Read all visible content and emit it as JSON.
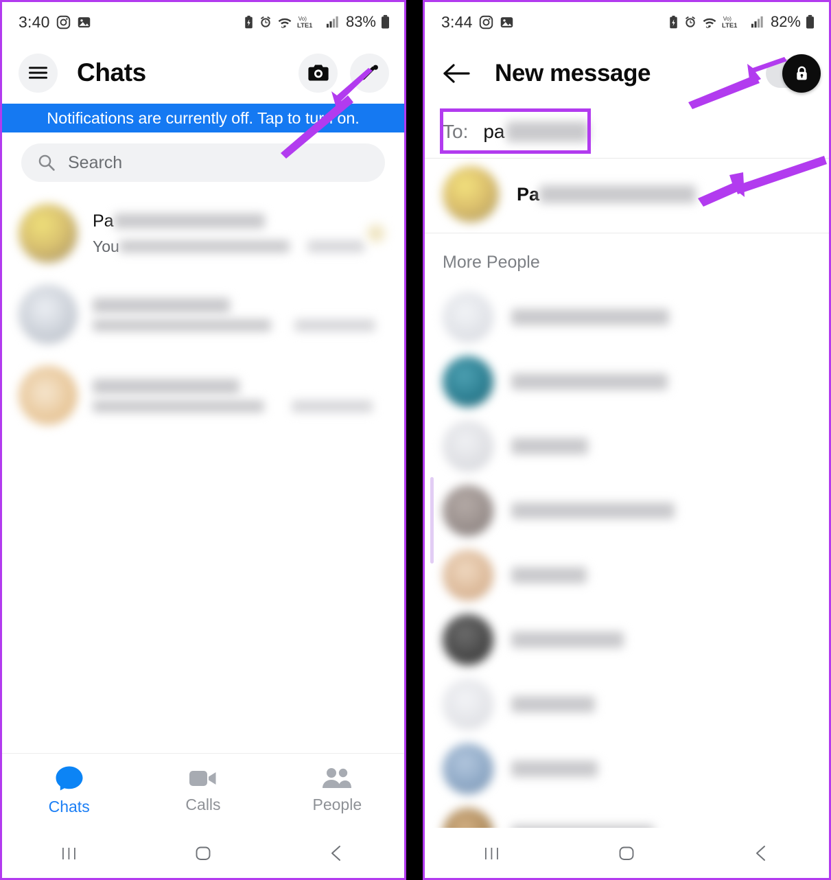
{
  "meta": {
    "accent_purple": "#b23bef",
    "banner_blue": "#1579f2",
    "tab_active_blue": "#1a7ef5"
  },
  "left_panel": {
    "status_bar": {
      "time": "3:40",
      "battery_percent": "83%",
      "network_label": "LTE1",
      "voice_label": "Vo)",
      "icons": [
        "instagram-icon",
        "photos-icon",
        "battery-saver-icon",
        "alarm-icon",
        "wifi-icon",
        "volte-icon",
        "signal-icon",
        "battery-icon"
      ]
    },
    "header": {
      "menu_icon": "hamburger-menu-icon",
      "title": "Chats",
      "camera_icon": "camera-icon",
      "compose_icon": "pencil-compose-icon"
    },
    "banner": {
      "text": "Notifications are currently off. Tap to turn on."
    },
    "search": {
      "icon": "search-icon",
      "placeholder": "Search"
    },
    "chats": [
      {
        "name_visible": "Pa",
        "name_redacted_width": 220,
        "snippet_visible": "You",
        "snippet_redacted_width": 250,
        "time_redacted_width": 84,
        "avatar_color": "#d9c170",
        "has_trailing_dot": true
      },
      {
        "name_visible": "",
        "name_redacted_width": 200,
        "snippet_visible": "",
        "snippet_redacted_width": 260,
        "time_redacted_width": 118,
        "avatar_color": "#c9ced6",
        "has_trailing_dot": false
      },
      {
        "name_visible": "",
        "name_redacted_width": 214,
        "snippet_visible": "",
        "snippet_redacted_width": 250,
        "time_redacted_width": 118,
        "avatar_color": "#e8c79a",
        "has_trailing_dot": false
      }
    ],
    "tabs": [
      {
        "label": "Chats",
        "icon": "chat-bubble-icon",
        "active": true
      },
      {
        "label": "Calls",
        "icon": "video-camera-icon",
        "active": false
      },
      {
        "label": "People",
        "icon": "people-icon",
        "active": false
      }
    ],
    "nav": [
      {
        "icon": "recents-icon"
      },
      {
        "icon": "home-icon"
      },
      {
        "icon": "back-icon"
      }
    ]
  },
  "right_panel": {
    "status_bar": {
      "time": "3:44",
      "battery_percent": "82%",
      "network_label": "LTE1",
      "voice_label": "Vo)"
    },
    "header": {
      "back_icon": "back-arrow-icon",
      "title": "New message",
      "toggle": {
        "name": "end-to-end-encryption-toggle",
        "icon": "lock-icon",
        "state": "on"
      }
    },
    "to_field": {
      "label": "To:",
      "value_visible": "pa",
      "value_redacted_width": 120
    },
    "suggested": {
      "name_visible": "Pa",
      "name_redacted_width": 228,
      "avatar_color": "#dcc06d"
    },
    "section_title": "More People",
    "people": [
      {
        "name_redacted_width": 230,
        "avatar_color": "#e0e2e7"
      },
      {
        "name_redacted_width": 228,
        "avatar_color": "#2d7f92"
      },
      {
        "name_redacted_width": 112,
        "avatar_color": "#dedfe3"
      },
      {
        "name_redacted_width": 238,
        "avatar_color": "#9b918e"
      },
      {
        "name_redacted_width": 110,
        "avatar_color": "#dbb898"
      },
      {
        "name_redacted_width": 164,
        "avatar_color": "#4a4a4a"
      },
      {
        "name_redacted_width": 122,
        "avatar_color": "#e3e4e8"
      },
      {
        "name_redacted_width": 126,
        "avatar_color": "#8fa9c6"
      },
      {
        "name_redacted_width": 208,
        "avatar_color": "#b08d5e"
      }
    ],
    "nav": [
      {
        "icon": "recents-icon"
      },
      {
        "icon": "home-icon"
      },
      {
        "icon": "back-icon"
      }
    ]
  },
  "annotations": [
    {
      "name": "arrow-to-compose-button",
      "target": "compose-icon"
    },
    {
      "name": "arrow-to-encryption-toggle",
      "target": "encryption-toggle"
    },
    {
      "name": "arrow-to-suggested-contact",
      "target": "suggested-contact-row"
    },
    {
      "name": "highlight-box-to-field",
      "target": "to-field"
    }
  ]
}
